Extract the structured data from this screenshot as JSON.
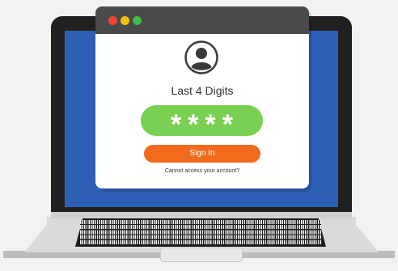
{
  "login": {
    "title": "Last 4 Digits",
    "pin_value": "****",
    "signin_label": "Sign In",
    "help_link": "Cannot access your account?"
  },
  "icons": {
    "avatar": "user-avatar-icon",
    "window_controls": [
      "close-dot",
      "minimize-dot",
      "maximize-dot"
    ]
  },
  "colors": {
    "screen": "#2d5fb4",
    "pin_field": "#7ad052",
    "signin_button": "#f26a1c",
    "titlebar": "#4a4a4a",
    "close": "#f04236",
    "minimize": "#f5c00f",
    "maximize": "#3ebc4a"
  }
}
